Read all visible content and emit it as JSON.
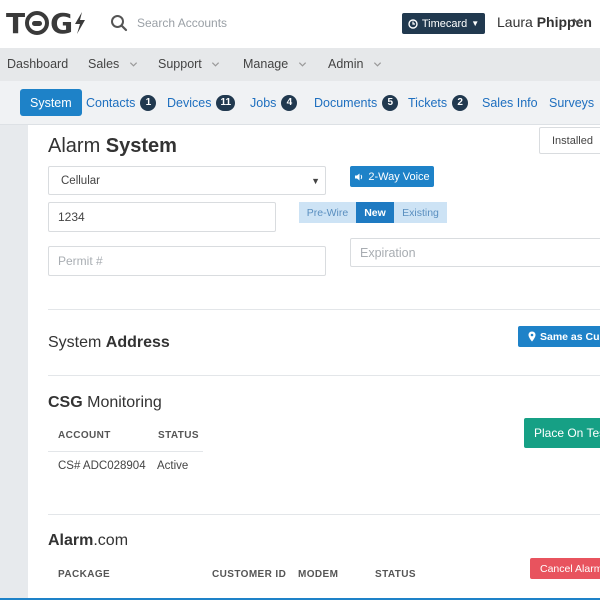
{
  "brand": {
    "logo_text": "TAG"
  },
  "search": {
    "placeholder": "Search Accounts"
  },
  "timecard": {
    "label": "Timecard"
  },
  "user": {
    "first_name": "Laura",
    "last_name": "Phippen"
  },
  "main_menu": [
    {
      "label": "Dashboard",
      "has_dropdown": false
    },
    {
      "label": "Sales",
      "has_dropdown": true
    },
    {
      "label": "Support",
      "has_dropdown": true
    },
    {
      "label": "Manage",
      "has_dropdown": true
    },
    {
      "label": "Admin",
      "has_dropdown": true
    }
  ],
  "tabs": [
    {
      "label": "System",
      "active": true
    },
    {
      "label": "Contacts",
      "badge": "1"
    },
    {
      "label": "Devices",
      "badge": "11"
    },
    {
      "label": "Jobs",
      "badge": "4"
    },
    {
      "label": "Documents",
      "badge": "5"
    },
    {
      "label": "Tickets",
      "badge": "2"
    },
    {
      "label": "Sales Info"
    },
    {
      "label": "Surveys"
    }
  ],
  "system": {
    "status_value": "Installed",
    "title_light": "Alarm",
    "title_bold": "System",
    "connection_type": "Cellular",
    "voice_button": "2-Way Voice",
    "code_value": "1234",
    "install_type": {
      "options": [
        "Pre-Wire",
        "New",
        "Existing"
      ],
      "selected": "New"
    },
    "permit_placeholder": "Permit #",
    "expiration_placeholder": "Expiration"
  },
  "address": {
    "title_light": "System",
    "title_bold": "Address",
    "same_button": "Same as Custo"
  },
  "monitoring": {
    "title_bold": "CSG",
    "title_light": "Monitoring",
    "columns": [
      "ACCOUNT",
      "STATUS"
    ],
    "rows": [
      {
        "account": "CS# ADC028904",
        "status": "Active"
      }
    ],
    "place_button": "Place On Tes"
  },
  "alarm_com": {
    "title_bold": "Alarm",
    "title_light": ".com",
    "columns": [
      "PACKAGE",
      "CUSTOMER ID",
      "MODEM",
      "STATUS"
    ],
    "cancel_button": "Cancel Alarm."
  },
  "colors": {
    "accent_blue": "#1e82c8",
    "navy": "#21394f",
    "green": "#16a085",
    "red": "#e8535e"
  }
}
